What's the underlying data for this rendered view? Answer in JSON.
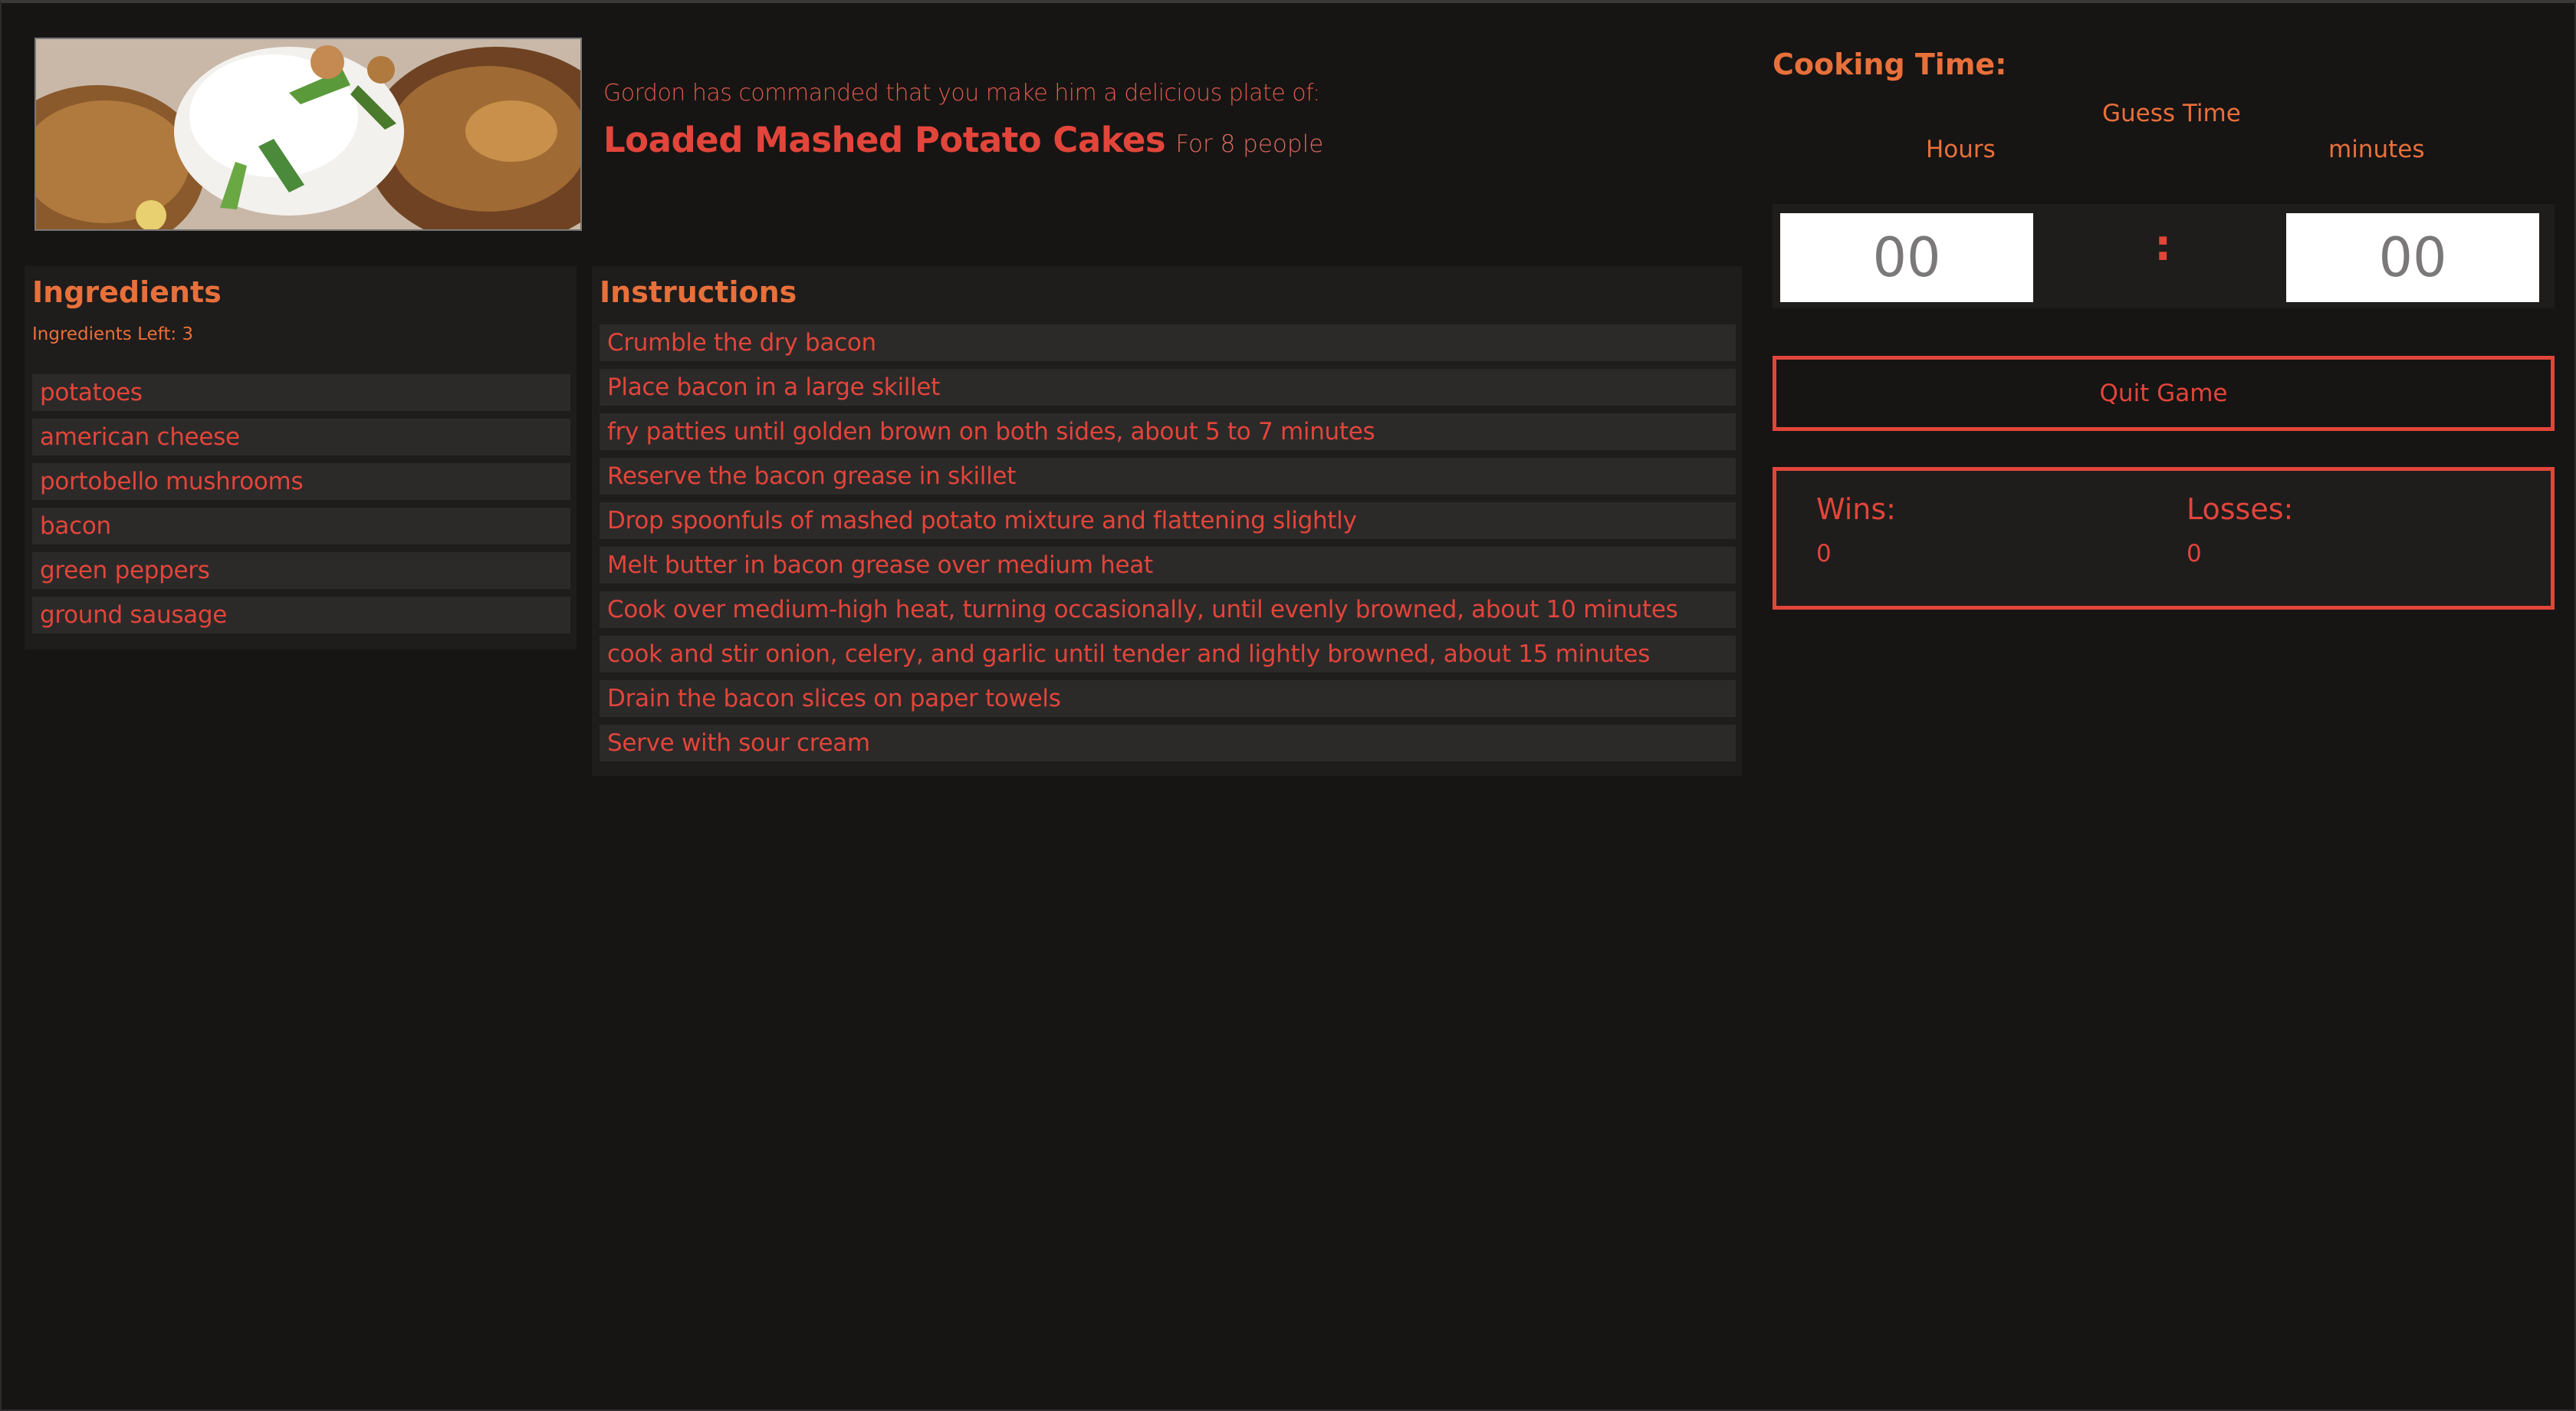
{
  "recipe": {
    "intro": "Gordon has commanded that you make him a delicious plate of:",
    "title": "Loaded Mashed Potato Cakes",
    "serves": "For 8 people"
  },
  "ingredients": {
    "heading": "Ingredients",
    "left_label": "Ingredients Left: 3",
    "items": [
      "potatoes",
      "american cheese",
      "portobello mushrooms",
      "bacon",
      "green peppers",
      "ground sausage"
    ]
  },
  "instructions": {
    "heading": "Instructions",
    "items": [
      "Crumble the dry bacon",
      "Place bacon in a large skillet",
      "fry patties until golden brown on both sides, about 5 to 7 minutes",
      "Reserve the bacon grease in skillet",
      "Drop spoonfuls of mashed potato mixture and flattening slightly",
      "Melt butter in bacon grease over medium heat",
      "Cook over medium-high heat, turning occasionally, until evenly browned, about 10 minutes",
      "cook and stir onion, celery, and garlic until tender and lightly browned, about 15 minutes",
      "Drain the bacon slices on paper towels",
      "Serve with sour cream"
    ]
  },
  "timer": {
    "heading": "Cooking Time:",
    "guess_label": "Guess Time",
    "hours_label": "Hours",
    "minutes_label": "minutes",
    "hours_value": "00",
    "minutes_value": "00",
    "separator": ":"
  },
  "controls": {
    "quit_label": "Quit Game"
  },
  "score": {
    "wins_label": "Wins:",
    "wins_value": "0",
    "losses_label": "Losses:",
    "losses_value": "0"
  },
  "colors": {
    "background": "#171414",
    "panel": "#1f1c1c",
    "item": "#2c2929",
    "accent_red": "#e2453a",
    "accent_orange": "#e8703a"
  },
  "icons": {
    "hero": "recipe-photo"
  }
}
